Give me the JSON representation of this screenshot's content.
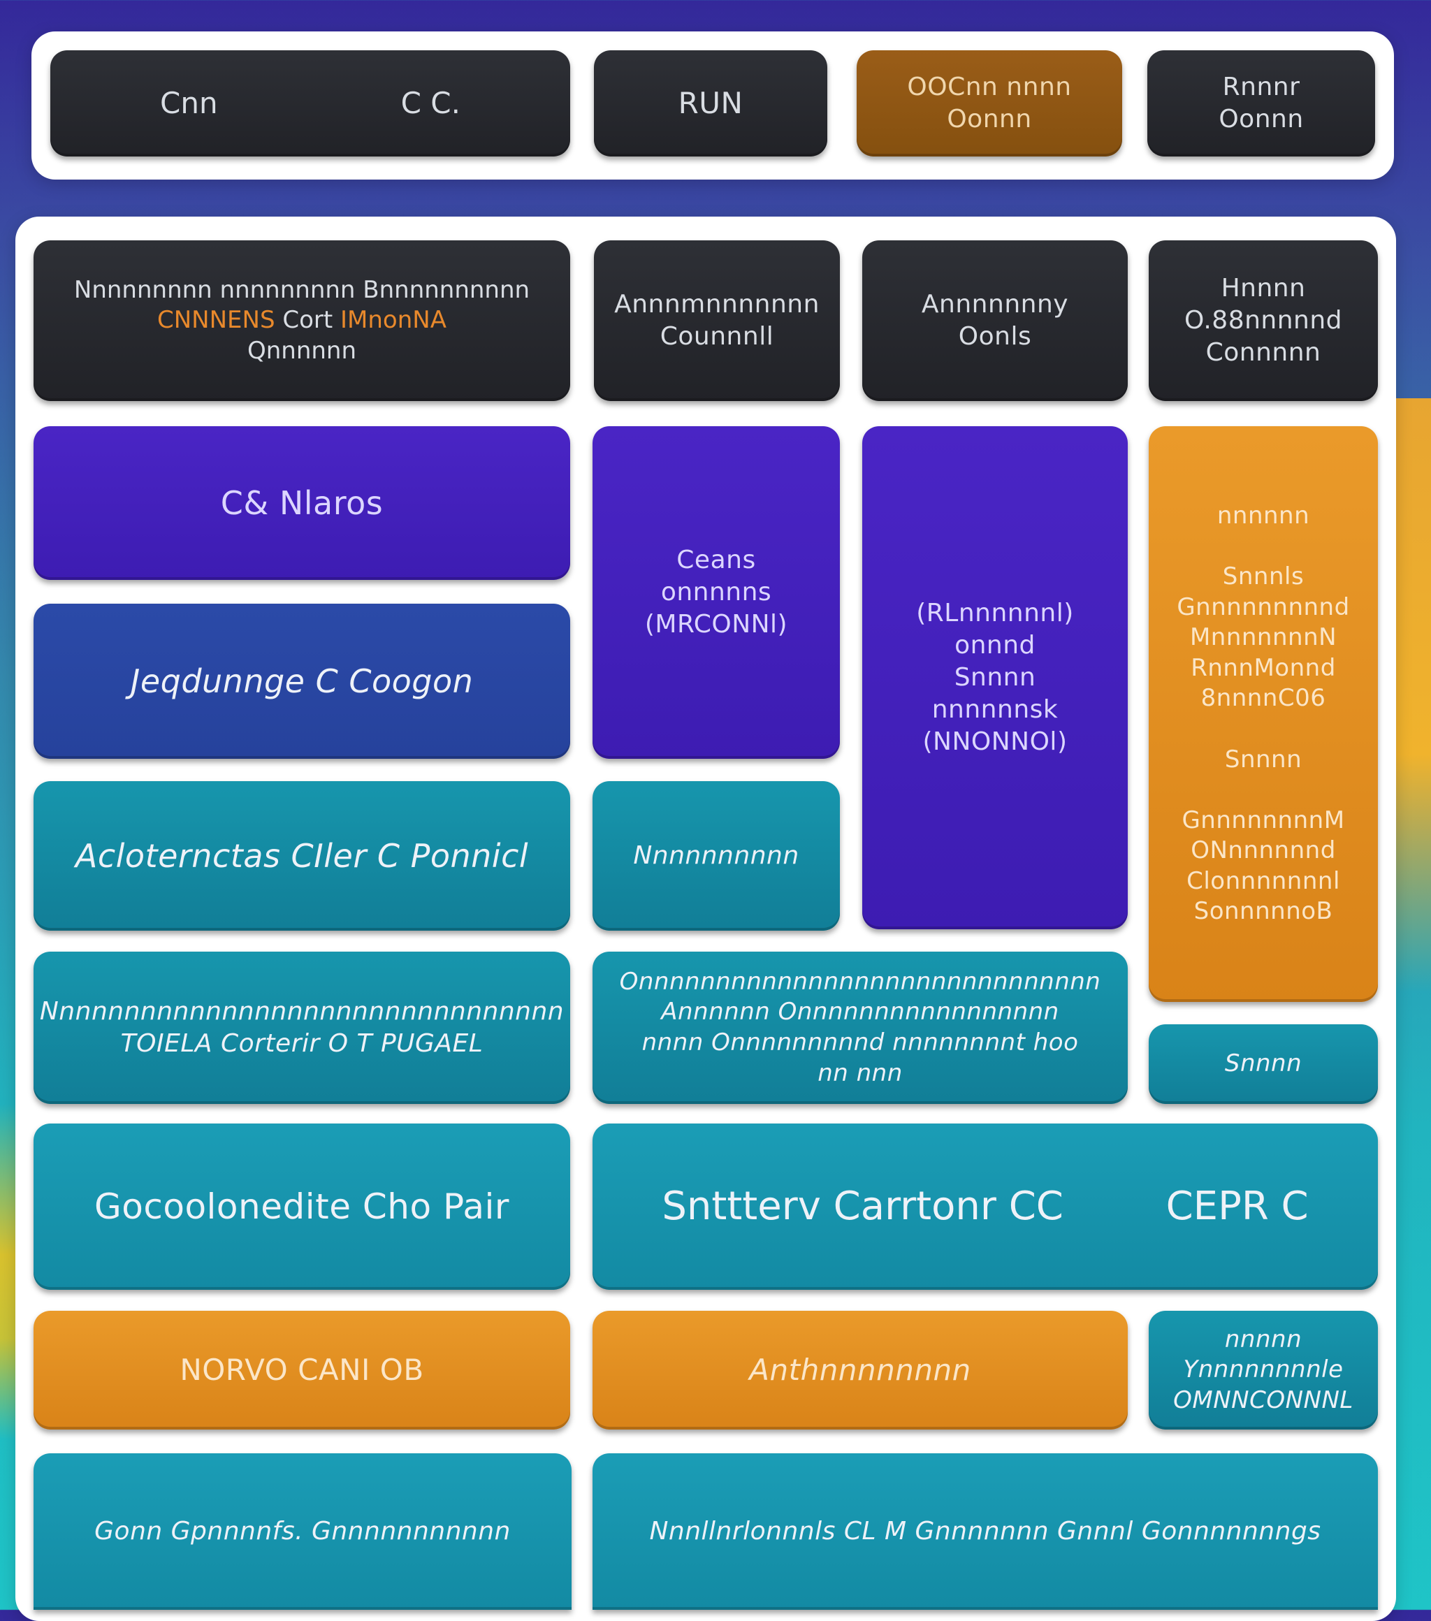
{
  "header": {
    "boxes": [
      {
        "left": "Cnn",
        "right": "C C."
      },
      "RUN",
      "OOCnn nnnn\nOonnn",
      "Rnnnr\nOonnn"
    ]
  },
  "grid": {
    "r1_a_line1": "Nnnnnnnnn nnnnnnnnn Bnnnnnnnnnn",
    "r1_a_hl1": "CNNNENS",
    "r1_a_mid": "Cort",
    "r1_a_hl2": "IMnonNA",
    "r1_a_line3": "Qnnnnnn",
    "r1_b": "Annnmnnnnnnn\nCounnnll",
    "r1_c": "Annnnnnny\nOonls",
    "r1_d": "Hnnnn\nO.88nnnnnd\nConnnnn",
    "r2_a": "C& Nlaros",
    "r2_b": "Ceans\nonnnnns\n(MRCONNl)",
    "r2_c": "(RLnnnnnnl)\nonnnd\nSnnnn\nnnnnnnsk\n(NNONNOl)",
    "r2_d": "nnnnnn\n\nSnnnls\nGnnnnnnnnnd\nMnnnnnnnN\nRnnnMonnd\n8nnnnC06\n\nSnnnn\n\nGnnnnnnnnM\nONnnnnnnd\nClonnnnnnnl\nSonnnnnoB",
    "r3_a": "Jeqdunnge C Coogon",
    "r4_a": "Acloternctas CIler C Ponnicl",
    "r4_b": "Nnnnnnnnnn",
    "r5_a": "Nnnnnnnnnnnnnnnnnnnnnnnnnnnnnnnn\nTOIELA Corterir O T PUGAEL",
    "r5_b": "Onnnnnnnnnnnnnnnnnnnnnnnnnnnnnn\nAnnnnnn Onnnnnnnnnnnnnnnnn\nnnnn Onnnnnnnnnd nnnnnnnnt hoo\nnn nnn",
    "r5_c": "Snnnn",
    "r6_a": "Gocoolonedite  Cho Pair",
    "r6_b_left": "Snttterv  Carrtonr  CC",
    "r6_b_right": "CEPR C",
    "r7_a": "NORVO CANI OB",
    "r7_b": "Anthnnnnnnnn",
    "r7_c": "nnnnn\nYnnnnnnnnle\nOMNNCONNNL",
    "r8_a": "Gonn Gpnnnnfs. Gnnnnnnnnnnn",
    "r8_b": "Nnnllnrlonnnls CL M Gnnnnnnn Gnnnl Gonnnnnnngs"
  },
  "colors": {
    "dark": "#26272c",
    "violet": "#4320bb",
    "indigo": "#2847a2",
    "teal": "#158aa2",
    "orange": "#e08d21",
    "brown": "#8f5713"
  }
}
